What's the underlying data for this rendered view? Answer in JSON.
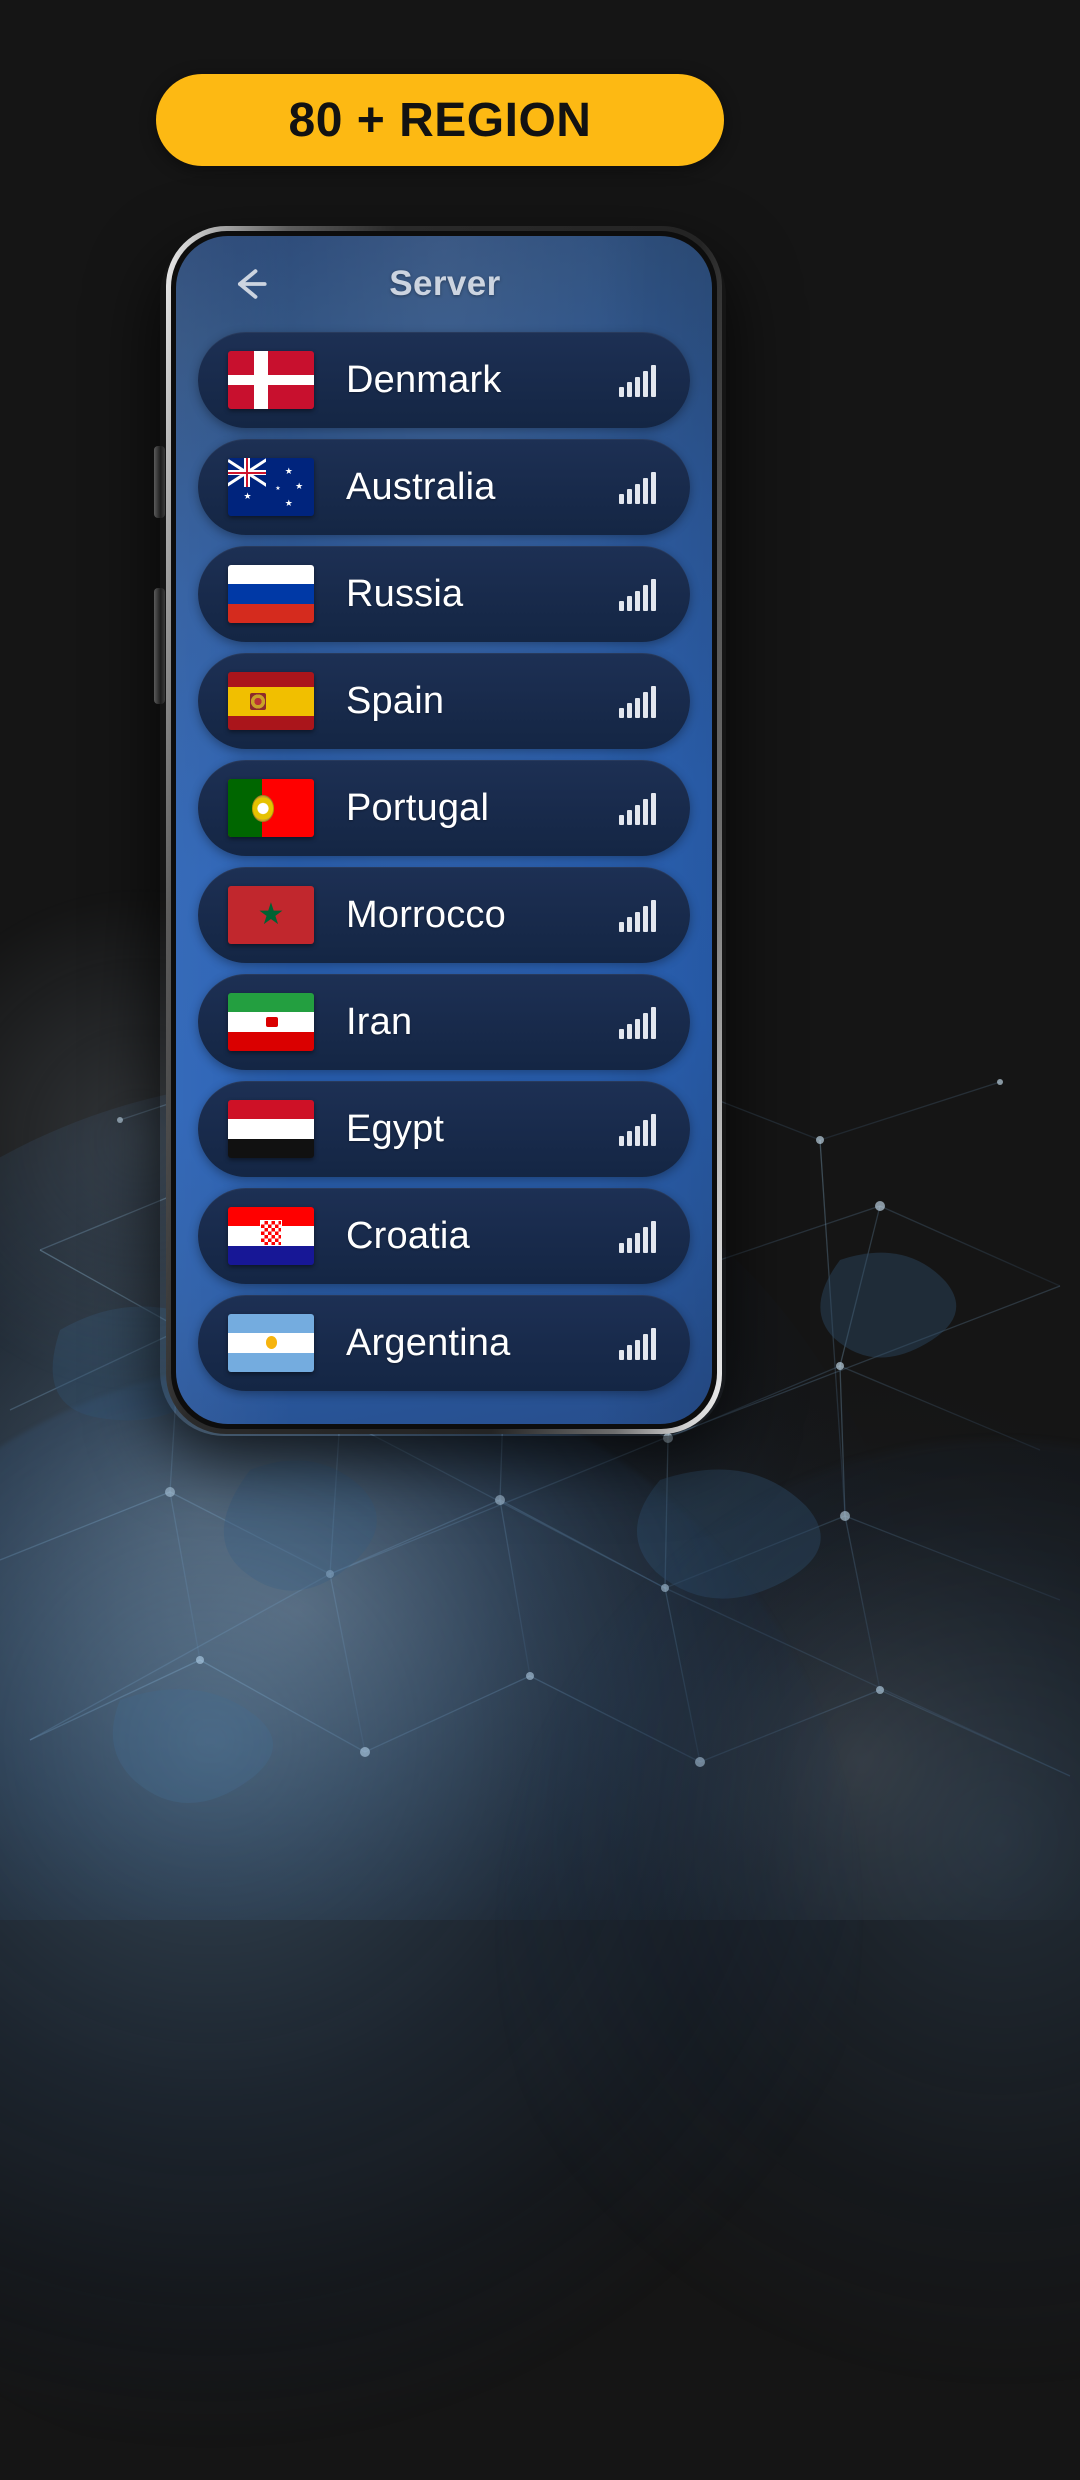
{
  "headline": {
    "text": "80 + REGION",
    "pill_color": "#FDB913",
    "text_color": "#121212"
  },
  "background": {
    "color": "#151515",
    "art": "world-globe-network"
  },
  "phone": {
    "frame_color": "#2a2a2a",
    "screen_gradient_from": "#2a4877",
    "screen_gradient_to": "#2a62b6"
  },
  "app": {
    "header": {
      "back_icon": "arrow-left-icon",
      "title": "Server",
      "title_color": "#ccd4e0"
    },
    "list": {
      "row_color": "#18294a",
      "signal_icon": "signal-bars-icon",
      "items": [
        {
          "country": "Denmark",
          "flag": "denmark-flag-icon",
          "signal": 5
        },
        {
          "country": "Australia",
          "flag": "australia-flag-icon",
          "signal": 5
        },
        {
          "country": "Russia",
          "flag": "russia-flag-icon",
          "signal": 5
        },
        {
          "country": "Spain",
          "flag": "spain-flag-icon",
          "signal": 5
        },
        {
          "country": "Portugal",
          "flag": "portugal-flag-icon",
          "signal": 5
        },
        {
          "country": "Morrocco",
          "flag": "morocco-flag-icon",
          "signal": 5
        },
        {
          "country": "Iran",
          "flag": "iran-flag-icon",
          "signal": 5
        },
        {
          "country": "Egypt",
          "flag": "egypt-flag-icon",
          "signal": 5
        },
        {
          "country": "Croatia",
          "flag": "croatia-flag-icon",
          "signal": 5
        },
        {
          "country": "Argentina",
          "flag": "argentina-flag-icon",
          "signal": 5
        }
      ]
    }
  }
}
